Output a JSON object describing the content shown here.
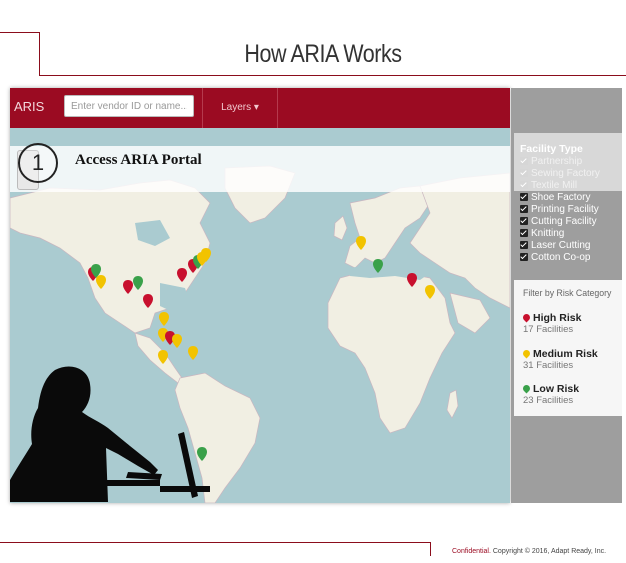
{
  "slide": {
    "title": "How ARIA Works",
    "footer_confidential": "Confidential.",
    "footer_copyright": "Copyright © 2016, Adapt Ready, Inc."
  },
  "app": {
    "logo": "ARIS",
    "search_placeholder": "Enter vendor ID or name...",
    "layers_label": "Layers ▾",
    "step_number": "1",
    "step_text": "Access ARIA Portal"
  },
  "facility_type": {
    "heading": "Facility Type",
    "items": [
      {
        "label": "Partnership",
        "checked": false
      },
      {
        "label": "Sewing Factory",
        "checked": false
      },
      {
        "label": "Textile Mill",
        "checked": false
      },
      {
        "label": "Shoe Factory",
        "checked": true
      },
      {
        "label": "Printing Facility",
        "checked": true
      },
      {
        "label": "Cutting Facility",
        "checked": true
      },
      {
        "label": "Knitting",
        "checked": true
      },
      {
        "label": "Laser Cutting",
        "checked": true
      },
      {
        "label": "Cotton Co-op",
        "checked": true
      }
    ]
  },
  "risk": {
    "heading": "Filter by Risk Category",
    "categories": [
      {
        "label": "High Risk",
        "count": "17 Facilities",
        "color": "#c8102e"
      },
      {
        "label": "Medium Risk",
        "count": "31 Facilities",
        "color": "#f2c300"
      },
      {
        "label": "Low Risk",
        "count": "23 Facilities",
        "color": "#3aa14a"
      }
    ]
  },
  "colors": {
    "brand": "#9b0b22",
    "water": "#aacbd0",
    "land": "#f1efe3"
  }
}
